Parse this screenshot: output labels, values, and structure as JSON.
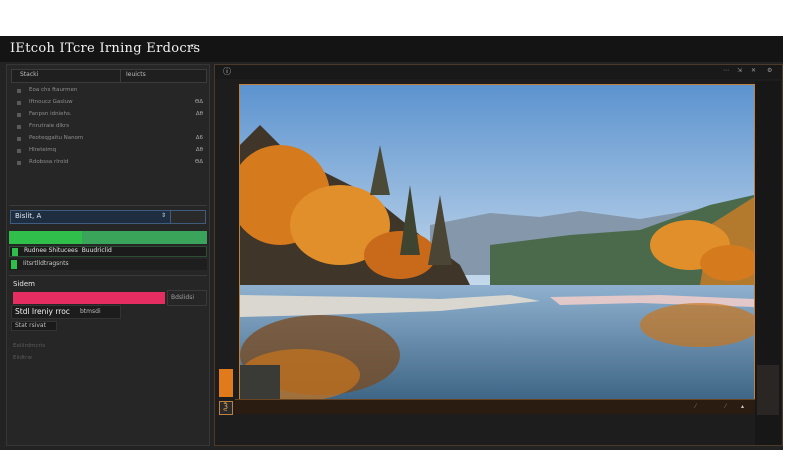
{
  "window": {
    "title": "IEtcoh ITcre Irning Erdocrs",
    "title_close": "▫"
  },
  "left_panel": {
    "tabs": [
      "Stacki",
      "Ieuicts"
    ],
    "list_items": [
      {
        "label": "Eoa chs ftaurmen",
        "value": ""
      },
      {
        "label": "Iftnoucz Gasluw",
        "value": "ΘΔ"
      },
      {
        "label": "Fanpsn idniehs.",
        "value": "Δθ"
      },
      {
        "label": "Fnrutraie dlkrs",
        "value": ""
      },
      {
        "label": "Peoteqgaitu Nanom",
        "value": "Δ6"
      },
      {
        "label": "Hlreteimq",
        "value": "Δθ"
      },
      {
        "label": "Rdobssa rlroid",
        "value": "ΘΔ"
      }
    ],
    "select_value": "Bislit, A",
    "select_arrow": "⇕",
    "progress": 0.37,
    "row_a": {
      "label": "Rudnee Shitucees",
      "suffix": "Buudriclid"
    },
    "row_b": {
      "label": "Iitsrtlldtragsnts"
    },
    "section_label": "Sidem",
    "pink_button": "Bdslidsi",
    "stats": {
      "label": "Stdl Ireniy rroc",
      "suffix": "btmsdi"
    },
    "small_label": "Stat rsivat",
    "faint_1": "Eeliirdmcris",
    "faint_2": "Eiidtrw"
  },
  "viewer": {
    "info_icon": "ⓘ",
    "toolbar": [
      "⋯",
      "⇲",
      "✕",
      "⚙"
    ],
    "corner_marker": "▴",
    "bottom_marker": "Ѯ",
    "strip_marks": [
      "⁄",
      "⁄"
    ]
  },
  "colors": {
    "accent_green": "#2fbf4a",
    "accent_pink": "#e62d61",
    "select_blue": "#1e2d40",
    "frame_orange": "#c0803e"
  }
}
